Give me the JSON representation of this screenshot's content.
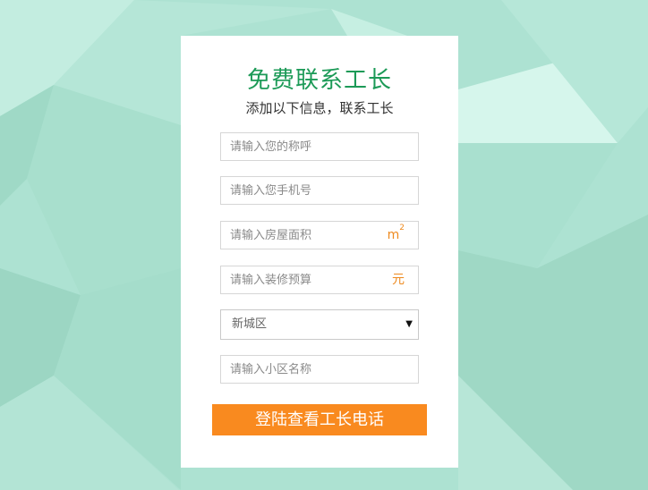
{
  "form": {
    "title": "免费联系工长",
    "subtitle": "添加以下信息，联系工长",
    "name_placeholder": "请输入您的称呼",
    "phone_placeholder": "请输入您手机号",
    "area_placeholder": "请输入房屋面积",
    "area_unit": "m",
    "area_unit_sup": "2",
    "budget_placeholder": "请输入装修预算",
    "budget_unit": "元",
    "district_value": "新城区",
    "community_placeholder": "请输入小区名称",
    "submit_label": "登陆查看工长电话"
  },
  "colors": {
    "background": "#ade2d2",
    "accent_green": "#1c9a57",
    "accent_orange": "#f98a1f"
  },
  "icons": {
    "dropdown": "triangle-down-icon"
  }
}
